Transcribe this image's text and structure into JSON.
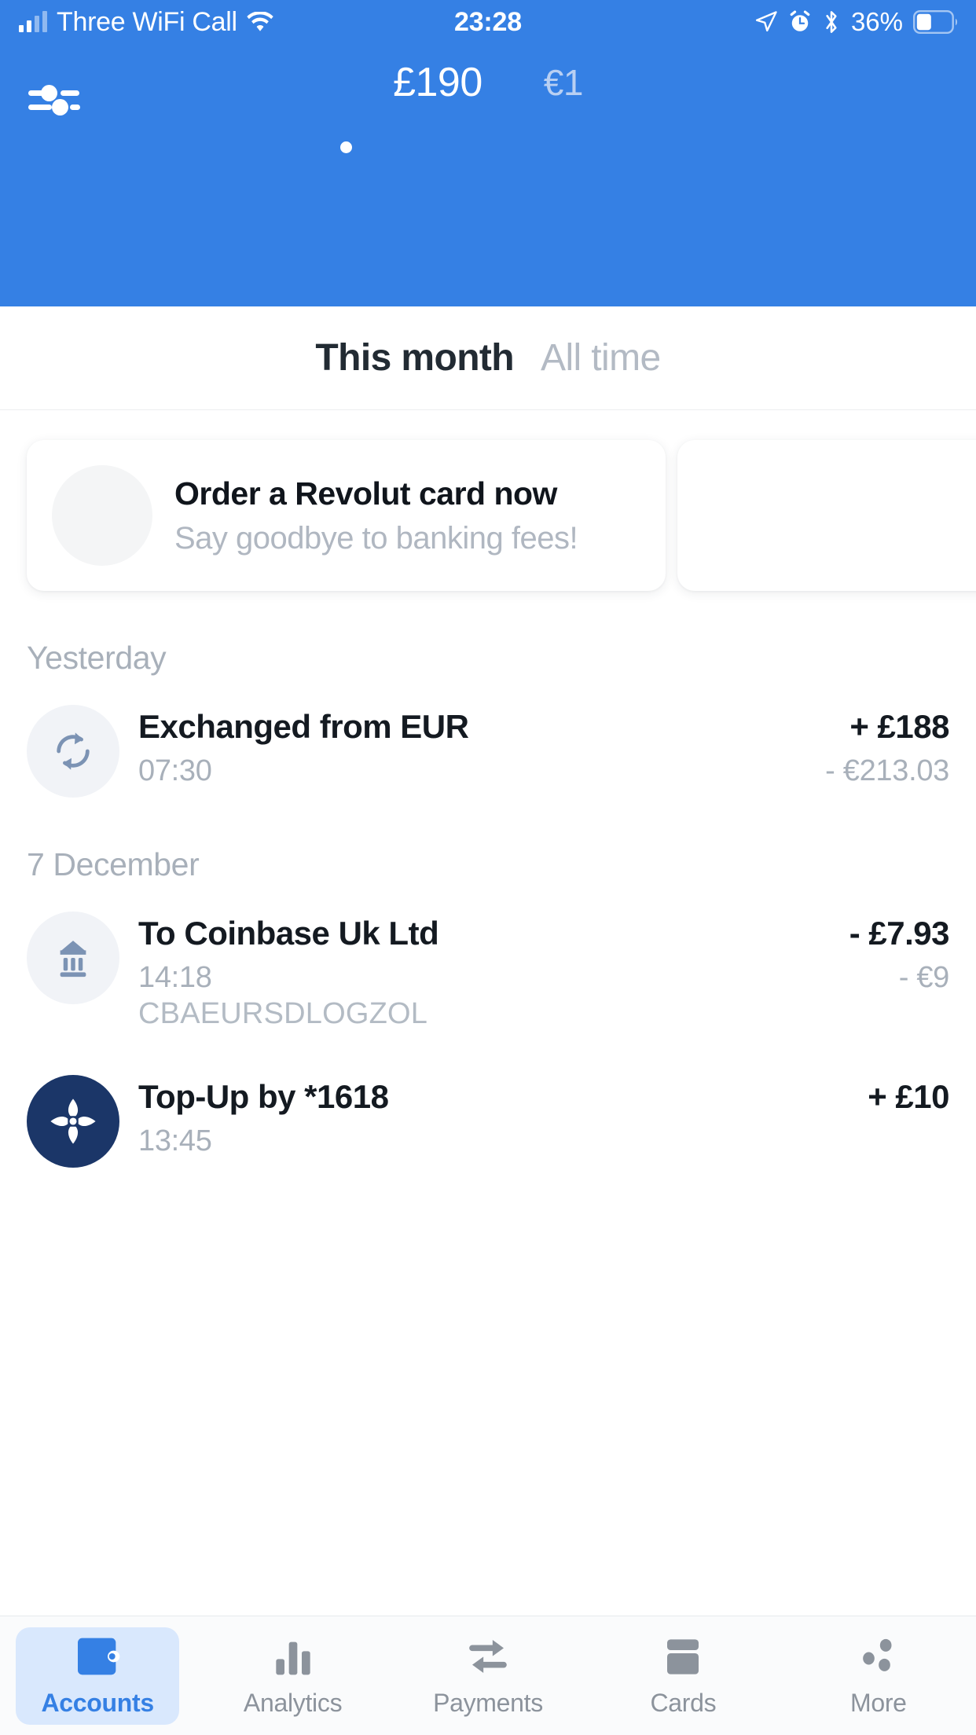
{
  "status_bar": {
    "carrier": "Three WiFi Call",
    "wifi_icon": "wifi-icon",
    "signal_icon": "cellular-signal-icon",
    "time": "23:28",
    "location_icon": "location-arrow-icon",
    "alarm_icon": "alarm-clock-icon",
    "bluetooth_icon": "bluetooth-icon",
    "battery_percent": "36%",
    "battery_icon": "battery-icon"
  },
  "header": {
    "filter_icon": "sliders-icon",
    "balance_primary": "£190",
    "balance_secondary": "€1",
    "page_indicator_dots": 1,
    "background_color": "#3580e4"
  },
  "period_tabs": [
    {
      "label": "This month",
      "active": true
    },
    {
      "label": "All time",
      "active": false
    }
  ],
  "promo": {
    "illustration_icon": "drone-delivery-card-icon",
    "title": "Order a Revolut card now",
    "subtitle": "Say goodbye to banking fees!"
  },
  "transactions": [
    {
      "date_header": "Yesterday",
      "items": [
        {
          "icon": "exchange-arrows-icon",
          "title": "Exchanged from EUR",
          "time": "07:30",
          "reference": "",
          "amount": "+ £188",
          "amount_secondary": "- €213.03"
        }
      ]
    },
    {
      "date_header": "7 December",
      "items": [
        {
          "icon": "bank-building-icon",
          "title": "To Coinbase Uk Ltd",
          "time": "14:18",
          "reference": "CBAEURSDLOGZOL",
          "amount": "- £7.93",
          "amount_secondary": "- €9"
        },
        {
          "icon": "rbs-bank-logo-icon",
          "title": "Top-Up by *1618",
          "time": "13:45",
          "reference": "",
          "amount": "+ £10",
          "amount_secondary": ""
        }
      ]
    }
  ],
  "tabbar": {
    "items": [
      {
        "label": "Accounts",
        "icon": "wallet-icon",
        "active": true
      },
      {
        "label": "Analytics",
        "icon": "bar-chart-icon",
        "active": false
      },
      {
        "label": "Payments",
        "icon": "transfer-arrows-icon",
        "active": false
      },
      {
        "label": "Cards",
        "icon": "credit-card-icon",
        "active": false
      },
      {
        "label": "More",
        "icon": "more-dots-icon",
        "active": false
      }
    ],
    "accent_color": "#3580e4",
    "inactive_color": "#8c939c"
  }
}
